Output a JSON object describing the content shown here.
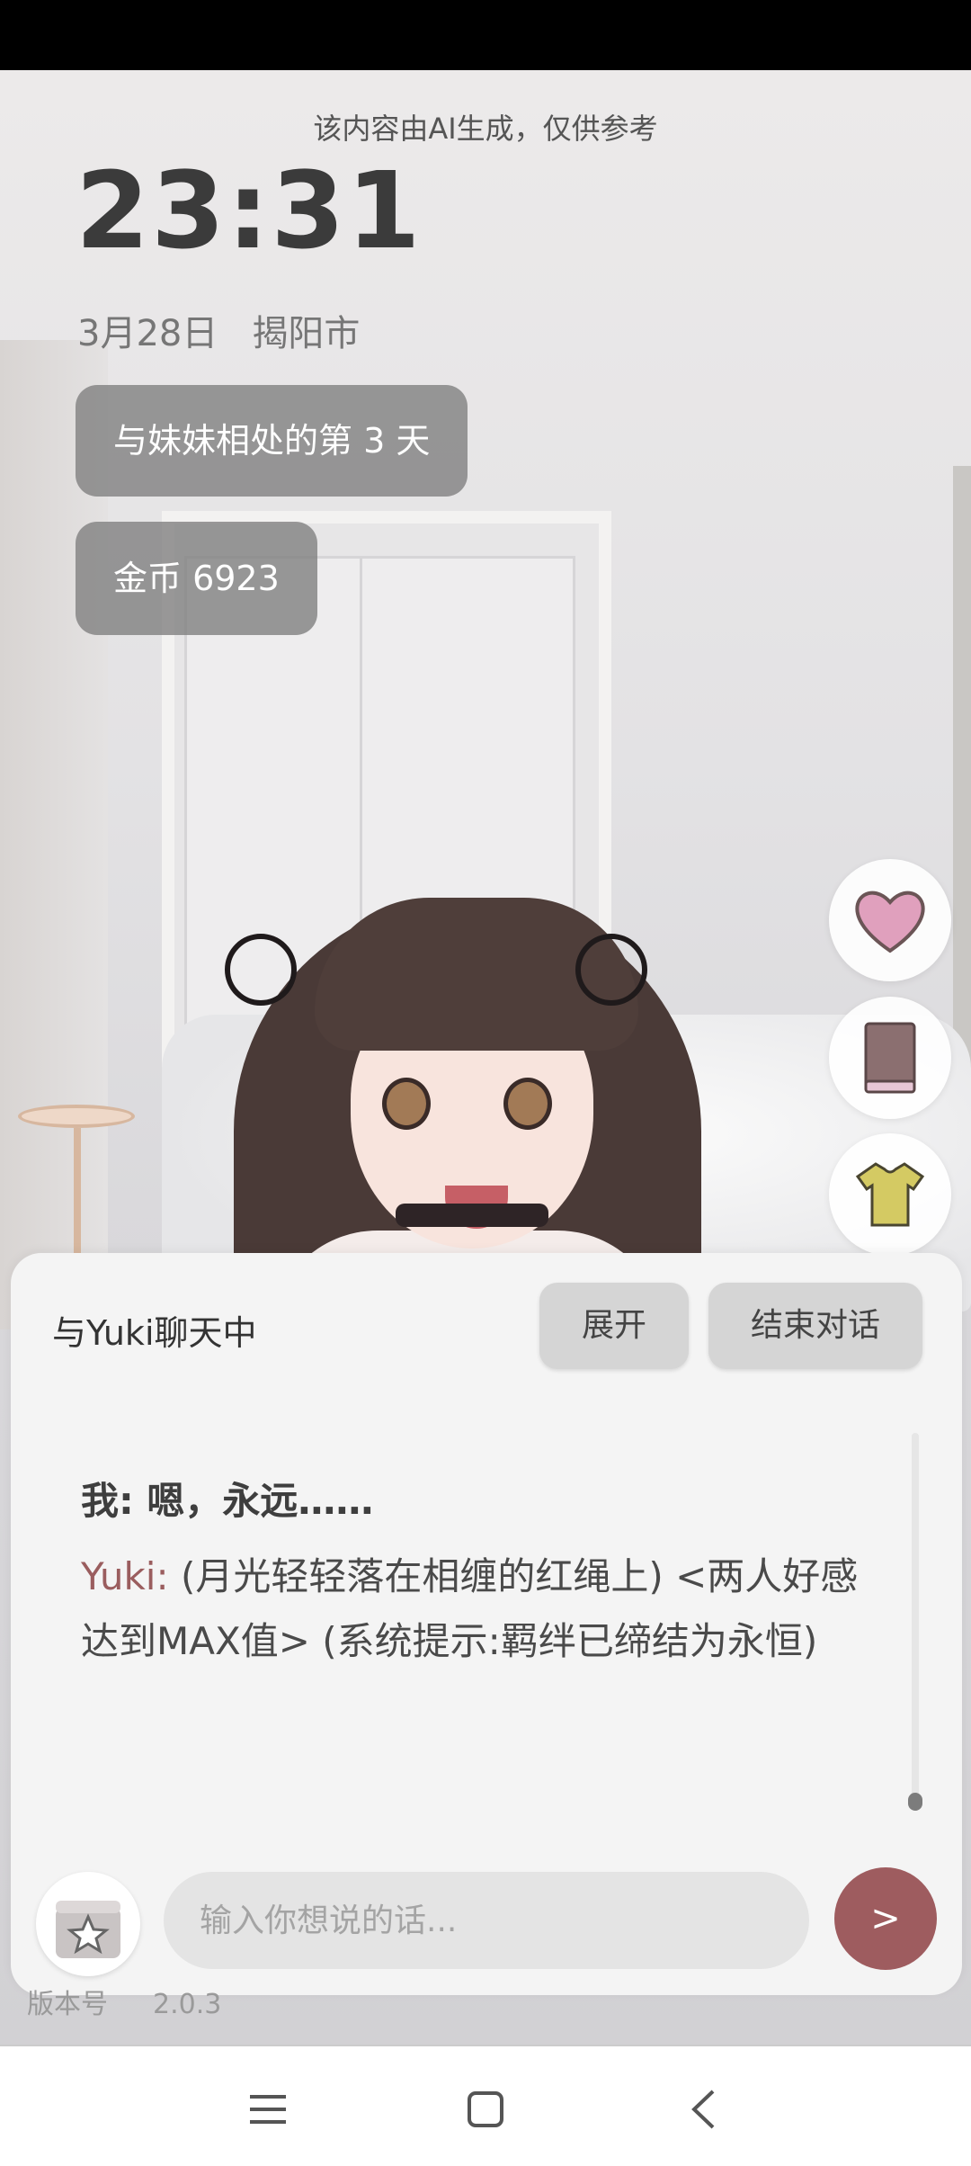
{
  "notice": "该内容由AI生成，仅供参考",
  "clock": "23:31",
  "date": "3月28日",
  "city": "揭阳市",
  "days_pill": "与妹妹相处的第 3 天",
  "coins_pill": "金币 6923",
  "side_actions": [
    "heart-icon",
    "book-icon",
    "shirt-icon"
  ],
  "chat": {
    "title": "与Yuki聊天中",
    "expand_label": "展开",
    "end_label": "结束对话",
    "messages": [
      {
        "speaker": "我:",
        "text": "嗯，永远……"
      },
      {
        "speaker": "Yuki:",
        "text": "(月光轻轻落在相缠的红绳上) <两人好感达到MAX值> (系统提示:羁绊已缔结为永恒)"
      }
    ],
    "input_placeholder": "输入你想说的话...",
    "send_label": ">"
  },
  "version": {
    "label": "版本号",
    "value": "2.0.3"
  },
  "colors": {
    "accent": "#9e5c5f",
    "heart": "#e0a0bd",
    "book": "#8b6f70",
    "shirt": "#d4ca63"
  }
}
